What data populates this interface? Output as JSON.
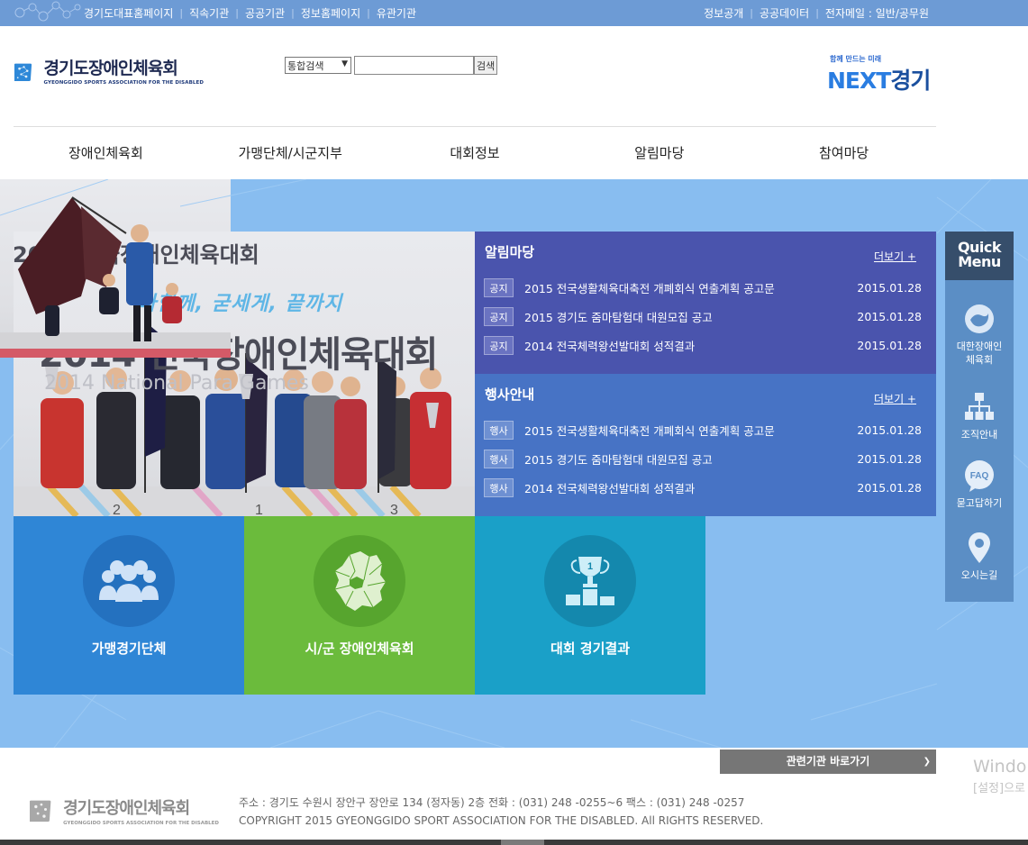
{
  "topbar": {
    "left_links": [
      "경기도대표홈페이지",
      "직속기관",
      "공공기관",
      "정보홈페이지",
      "유관기관"
    ],
    "right_links": [
      "정보공개",
      "공공데이터",
      "전자메일 : 일반/공무원"
    ]
  },
  "logo": {
    "name": "경기도장애인체육회",
    "subtitle": "GYEONGGIDO SPORTS ASSOCIATION FOR THE DISABLED"
  },
  "search": {
    "selected": "통합검색",
    "value": "",
    "button": "검색"
  },
  "brand": {
    "tagline": "함께 만드는 미래",
    "word_next": "NEXT",
    "word_gyeonggi": "경기"
  },
  "gnb": [
    "장애인체육회",
    "가맹단체/시군지부",
    "대회정보",
    "알림마당",
    "참여마당"
  ],
  "hero": {
    "slogan": "다함께, 굳세게, 끝까지",
    "title": "2014 전국장애인체육대회",
    "subtitle": "2014 National Para Games"
  },
  "notice_panel": {
    "title": "알림마당",
    "more": "더보기 +",
    "rows": [
      {
        "badge": "공지",
        "text": "2015 전국생활체육대축전 개폐회식 연출계획 공고문",
        "date": "2015.01.28"
      },
      {
        "badge": "공지",
        "text": "2015 경기도 줌마탐험대 대원모집 공고",
        "date": "2015.01.28"
      },
      {
        "badge": "공지",
        "text": "2014 전국체력왕선발대회 성적결과",
        "date": "2015.01.28"
      }
    ]
  },
  "event_panel": {
    "title": "행사안내",
    "more": "더보기 +",
    "rows": [
      {
        "badge": "행사",
        "text": "2015 전국생활체육대축전 개폐회식 연출계획 공고문",
        "date": "2015.01.28"
      },
      {
        "badge": "행사",
        "text": "2015 경기도 줌마탐험대 대원모집 공고",
        "date": "2015.01.28"
      },
      {
        "badge": "행사",
        "text": "2014 전국체력왕선발대회 성적결과",
        "date": "2015.01.28"
      }
    ]
  },
  "tiles": [
    "가맹경기단체",
    "시/군 장애인체육회",
    "대회 경기결과"
  ],
  "photo2": {
    "title": "2014 전국장애인체육대회"
  },
  "quick_menu": {
    "title_line1": "Quick",
    "title_line2": "Menu",
    "items": [
      {
        "label": "대한장애인\n체육회",
        "icon": "kpc-icon"
      },
      {
        "label": "조직안내",
        "icon": "org-chart-icon"
      },
      {
        "label": "묻고답하기",
        "icon": "faq-icon"
      },
      {
        "label": "오시는길",
        "icon": "location-pin-icon"
      }
    ]
  },
  "footer": {
    "related_select": "관련기관 바로가기",
    "logo_name": "경기도장애인체육회",
    "logo_sub": "GYEONGGIDO SPORTS ASSOCIATION FOR THE DISABLED",
    "address": "주소 : 경기도 수원시 장안구 장안로 134 (정자동) 2층 전화 : (031) 248 -0255~6 팩스 : (031) 248 -0257",
    "copyright": "COPYRIGHT 2015 GYEONGGIDO SPORT ASSOCIATION FOR THE DISABLED. All RIGHTS RESERVED."
  },
  "watermark": {
    "line1": "Windo",
    "line2": "[설정]으로"
  },
  "colors": {
    "topbar": "#6d9bd5",
    "band": "#88bdf0",
    "notice_panel": "#4a54ad",
    "event_panel": "#4773c5",
    "tile_blue": "#2f86d6",
    "tile_green": "#6bbb3c",
    "tile_teal": "#1aa0c8",
    "quick_head": "#364e6b",
    "quick_body": "#5b8ec5"
  }
}
